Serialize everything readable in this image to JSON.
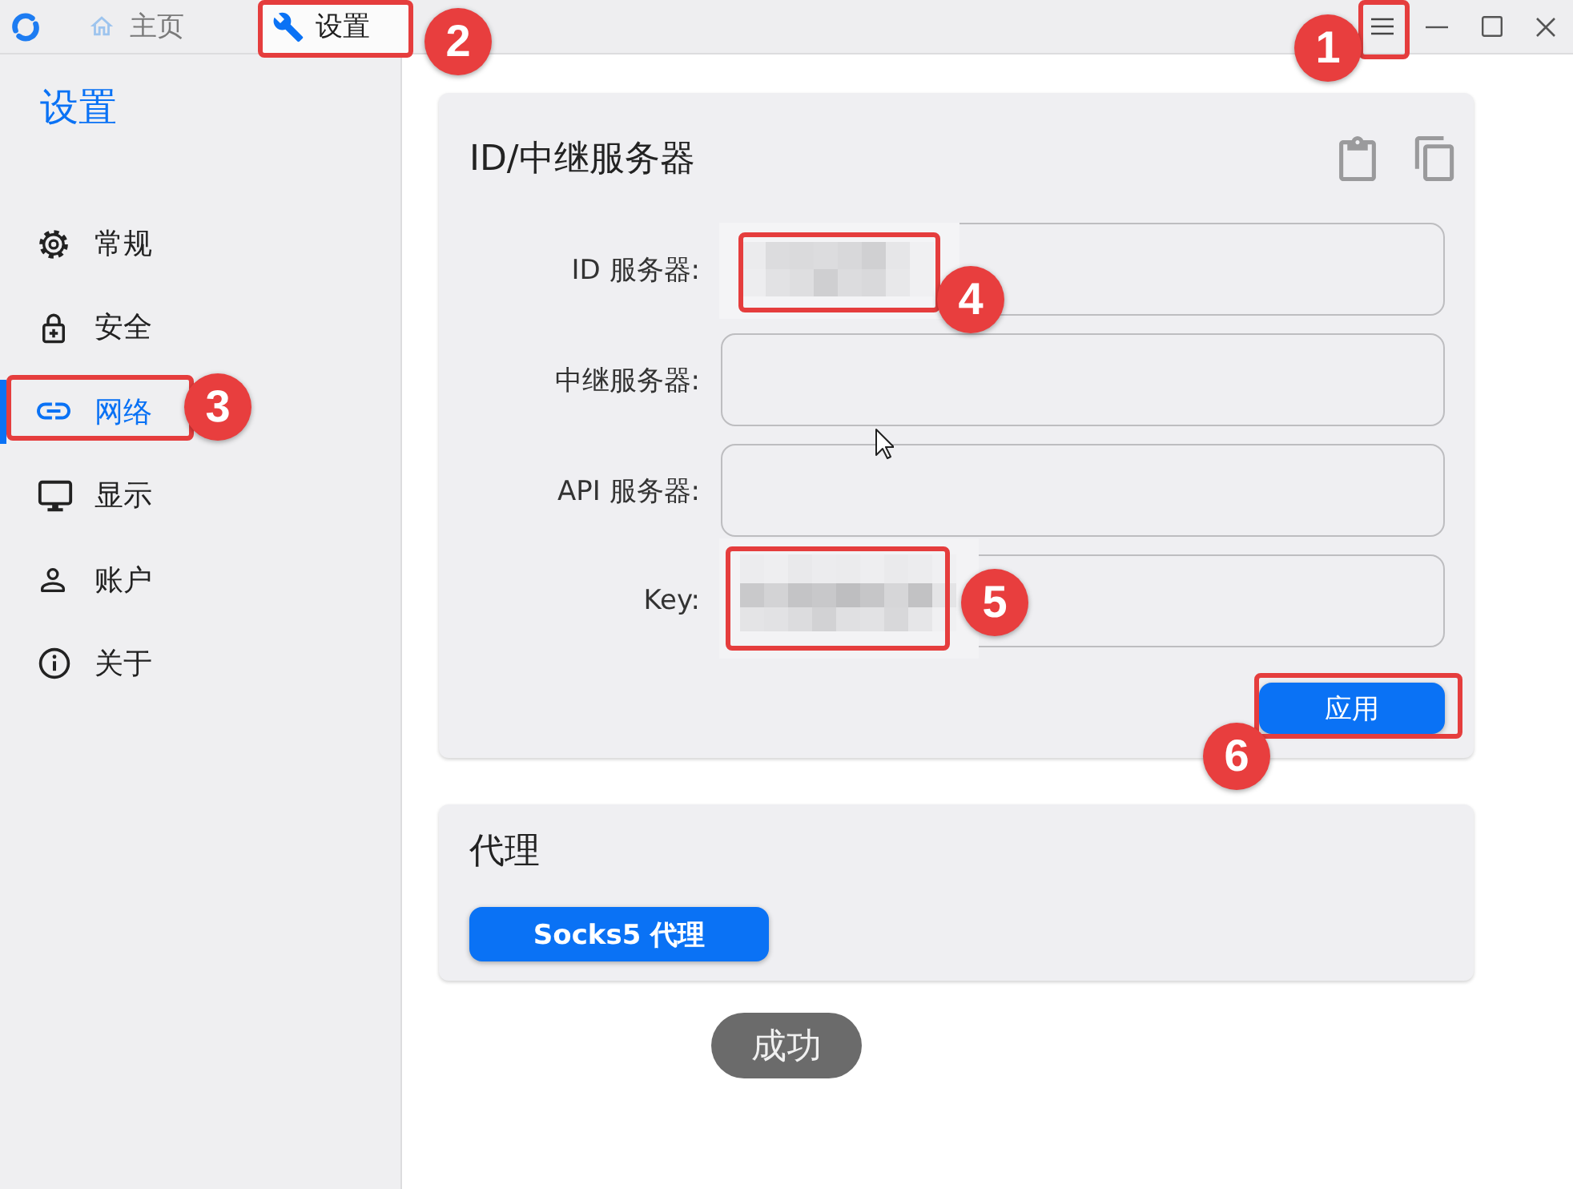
{
  "title_bar": {
    "tabs": [
      {
        "label": "主页",
        "selected": false
      },
      {
        "label": "设置",
        "selected": true
      }
    ]
  },
  "sidebar": {
    "title": "设置",
    "items": [
      {
        "label": "常规",
        "selected": false
      },
      {
        "label": "安全",
        "selected": false
      },
      {
        "label": "网络",
        "selected": true
      },
      {
        "label": "显示",
        "selected": false
      },
      {
        "label": "账户",
        "selected": false
      },
      {
        "label": "关于",
        "selected": false
      }
    ]
  },
  "server_card": {
    "title": "ID/中继服务器",
    "fields": [
      {
        "label": "ID 服务器:",
        "redacted": true
      },
      {
        "label": "中继服务器:",
        "redacted": false
      },
      {
        "label": "API 服务器:",
        "redacted": false
      },
      {
        "label": "Key:",
        "redacted": true
      }
    ],
    "apply_button": "应用"
  },
  "proxy_card": {
    "title": "代理",
    "button": "Socks5 代理"
  },
  "toast": "成功",
  "annotations": [
    {
      "number": "1"
    },
    {
      "number": "2"
    },
    {
      "number": "3"
    },
    {
      "number": "4"
    },
    {
      "number": "5"
    },
    {
      "number": "6"
    }
  ]
}
